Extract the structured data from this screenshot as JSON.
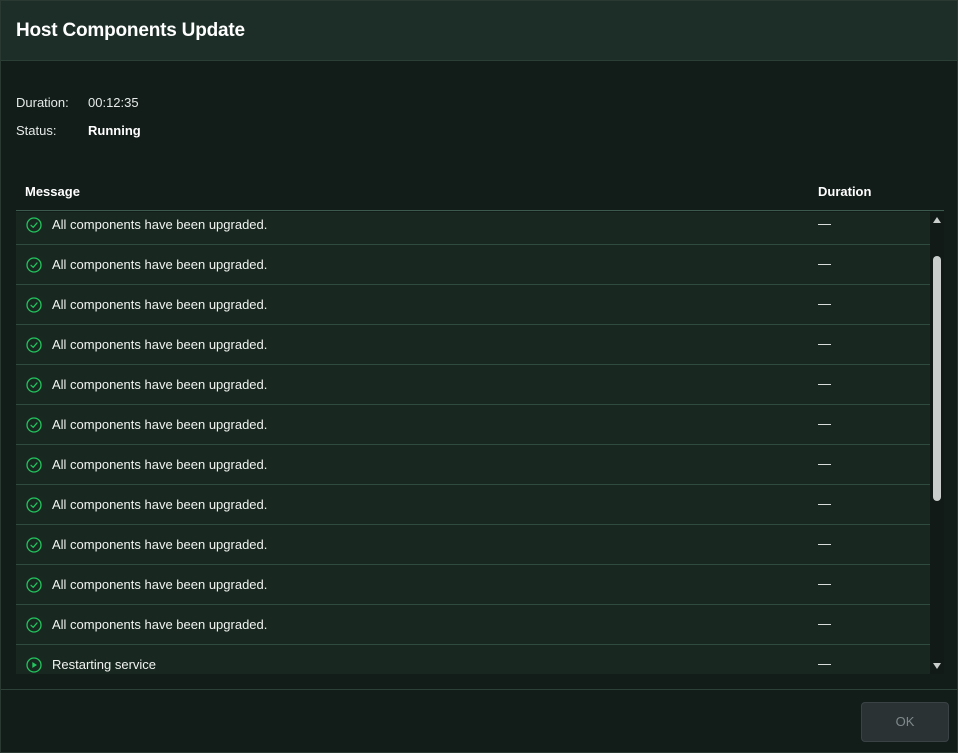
{
  "dialog": {
    "title": "Host Components Update"
  },
  "info": {
    "duration_label": "Duration:",
    "duration_value": "00:12:35",
    "status_label": "Status:",
    "status_value": "Running"
  },
  "table": {
    "columns": [
      "Message",
      "Duration"
    ],
    "rows": [
      {
        "icon": "check-circle-icon",
        "message": "All components have been upgraded.",
        "duration": "—"
      },
      {
        "icon": "check-circle-icon",
        "message": "All components have been upgraded.",
        "duration": "—"
      },
      {
        "icon": "check-circle-icon",
        "message": "All components have been upgraded.",
        "duration": "—"
      },
      {
        "icon": "check-circle-icon",
        "message": "All components have been upgraded.",
        "duration": "—"
      },
      {
        "icon": "check-circle-icon",
        "message": "All components have been upgraded.",
        "duration": "—"
      },
      {
        "icon": "check-circle-icon",
        "message": "All components have been upgraded.",
        "duration": "—"
      },
      {
        "icon": "check-circle-icon",
        "message": "All components have been upgraded.",
        "duration": "—"
      },
      {
        "icon": "check-circle-icon",
        "message": "All components have been upgraded.",
        "duration": "—"
      },
      {
        "icon": "check-circle-icon",
        "message": "All components have been upgraded.",
        "duration": "—"
      },
      {
        "icon": "check-circle-icon",
        "message": "All components have been upgraded.",
        "duration": "—"
      },
      {
        "icon": "check-circle-icon",
        "message": "All components have been upgraded.",
        "duration": "—"
      },
      {
        "icon": "play-circle-icon",
        "message": "Restarting service",
        "duration": "—"
      }
    ]
  },
  "footer": {
    "ok_label": "OK"
  },
  "colors": {
    "success": "#22c55e",
    "background": "#121c18",
    "header": "#1c2e27"
  }
}
